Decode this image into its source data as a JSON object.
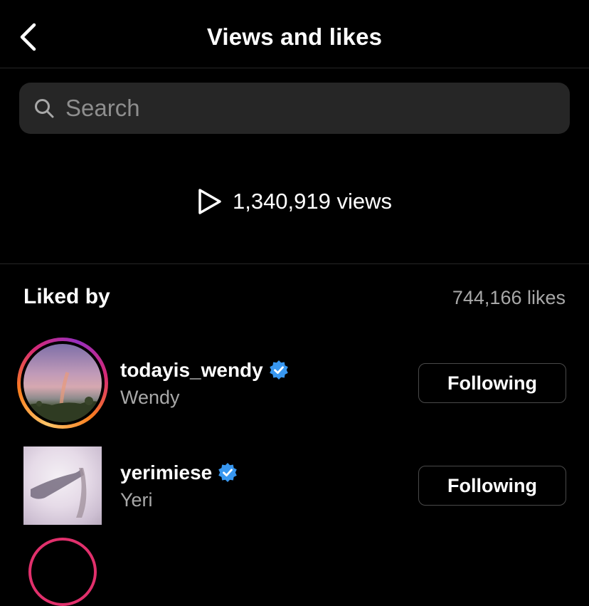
{
  "header": {
    "title": "Views and likes"
  },
  "search": {
    "placeholder": "Search"
  },
  "views": {
    "count_text": "1,340,919 views"
  },
  "liked_by": {
    "title": "Liked by",
    "count_text": "744,166 likes",
    "users": [
      {
        "username": "todayis_wendy",
        "name": "Wendy",
        "verified": true,
        "has_story_ring": true,
        "button_label": "Following"
      },
      {
        "username": "yerimiese",
        "name": "Yeri",
        "verified": true,
        "has_story_ring": false,
        "button_label": "Following"
      }
    ]
  },
  "icons": {
    "back": "chevron-left-icon",
    "search": "search-icon",
    "views": "play-icon",
    "verified": "verified-badge-icon"
  },
  "colors": {
    "background": "#000000",
    "search_bg": "#262626",
    "secondary_text": "#a8a8a8",
    "verified_blue": "#3897f0"
  }
}
